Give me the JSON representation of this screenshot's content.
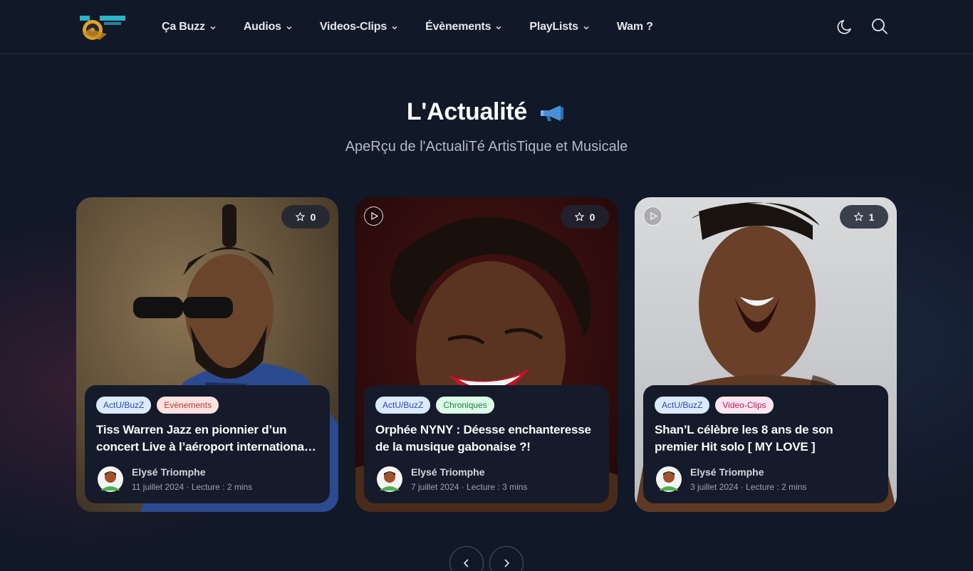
{
  "header": {
    "nav": [
      {
        "label": "Ça Buzz",
        "has_dropdown": true
      },
      {
        "label": "Audios",
        "has_dropdown": true
      },
      {
        "label": "Videos-Clips",
        "has_dropdown": true
      },
      {
        "label": "Évènements",
        "has_dropdown": true
      },
      {
        "label": "PlayLists",
        "has_dropdown": true
      },
      {
        "label": "Wam ?",
        "has_dropdown": false
      }
    ],
    "icons": [
      "moon-icon",
      "search-icon"
    ]
  },
  "section": {
    "title": "L'Actualité",
    "title_icon": "megaphone-icon",
    "subtitle": "ApeRçu de l'ActualiTé ArtisTique et Musicale"
  },
  "cards": [
    {
      "stars": "0",
      "has_play": false,
      "tags": [
        {
          "label": "ActU/BuzZ",
          "color": "blue"
        },
        {
          "label": "Evènements",
          "color": "red"
        }
      ],
      "title": "Tiss Warren Jazz en pionnier d’un concert Live à l’aéroport international Léon Mba",
      "author": "Elysé Triomphe",
      "meta": "11 juillet 2024 · Lecture : 2 mins"
    },
    {
      "stars": "0",
      "has_play": true,
      "tags": [
        {
          "label": "ActU/BuzZ",
          "color": "blue"
        },
        {
          "label": "Chroniques",
          "color": "green"
        }
      ],
      "title": "Orphée NYNY : Déesse enchanteresse de la musique gabonaise ?!",
      "author": "Elysé Triomphe",
      "meta": "7 juillet 2024 · Lecture : 3 mins"
    },
    {
      "stars": "1",
      "has_play": true,
      "tags": [
        {
          "label": "ActU/BuzZ",
          "color": "blue"
        },
        {
          "label": "Video-Clips",
          "color": "pink"
        }
      ],
      "title": "Shan’L célèbre les 8 ans de son premier Hit solo [ MY LOVE ]",
      "author": "Elysé Triomphe",
      "meta": "3 juillet 2024 · Lecture : 2 mins"
    }
  ],
  "slider": {
    "prev_icon": "chevron-left-icon",
    "next_icon": "chevron-right-icon"
  }
}
